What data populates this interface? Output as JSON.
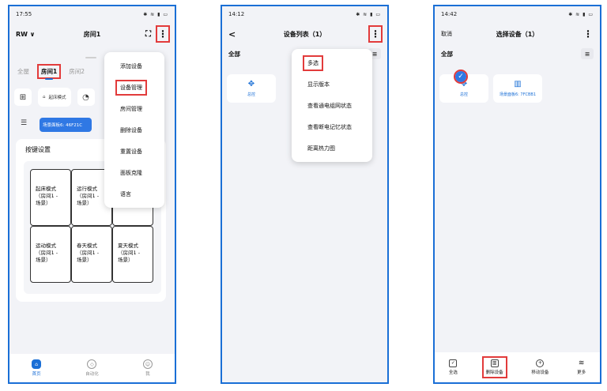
{
  "screen1": {
    "status": {
      "time": "17:55",
      "icons": "✱ ≋ ▮ ▭"
    },
    "header": {
      "left": "RW ∨",
      "title": "房间1"
    },
    "tabs": [
      "全屋",
      "房间1",
      "房间2"
    ],
    "scene": {
      "label": "起床模式"
    },
    "panel_chip": "场景面板6: 46F21C",
    "card_title": "按键设置",
    "keys": [
      "起床模式\n（房间1 -\n场景）",
      "运行模式\n（房间1 -\n场景）",
      "",
      "运动模式\n（房间1 -\n场景）",
      "春天模式\n（房间1 -\n场景）",
      "夏天模式\n（房间1 -\n场景）"
    ],
    "menu": [
      "添加设备",
      "设备管理",
      "房间管理",
      "删除设备",
      "重置设备",
      "面板克隆",
      "语言"
    ],
    "bottom_nav": [
      "首页",
      "自动化",
      "我"
    ]
  },
  "screen2": {
    "status": {
      "time": "14:12",
      "icons": "✱ ≋ ▮ ▭"
    },
    "header": {
      "back": "<",
      "title": "设备列表（1）"
    },
    "filter": "全部",
    "device_label": "总控",
    "menu": [
      "多选",
      "显示版本",
      "查看通电组网状态",
      "查看断电记忆状态",
      "距离热力图"
    ]
  },
  "screen3": {
    "status": {
      "time": "14:42",
      "icons": "✱ ≋ ▮ ▭"
    },
    "header": {
      "cancel": "取消",
      "title": "选择设备（1）"
    },
    "filter": "全部",
    "devices": [
      "总控",
      "场景面板6: 7FCBB1"
    ],
    "actions": [
      "全选",
      "删除设备",
      "移动设备",
      "更多"
    ]
  },
  "colors": {
    "accent": "#1a6fd6",
    "highlight": "#e23b3b"
  },
  "icons": {
    "kebab": "more-vertical-icon",
    "hamburger": "list-icon",
    "check": "check-circle-icon"
  }
}
